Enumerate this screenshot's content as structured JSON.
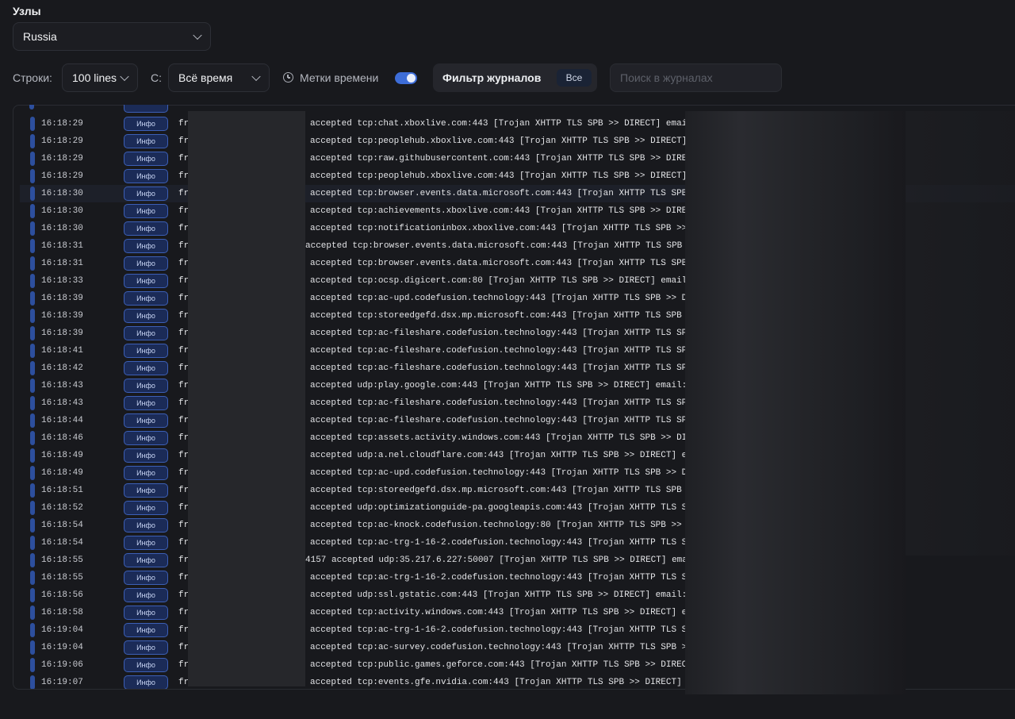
{
  "nodes": {
    "label": "Узлы",
    "selected": "Russia"
  },
  "toolbar": {
    "lines_label": "Строки:",
    "lines_value": "100 lines",
    "from_label": "С:",
    "from_value": "Всё время",
    "timestamps_label": "Метки времени",
    "timestamps_enabled": true,
    "filter_label": "Фильтр журналов",
    "filter_value": "Все",
    "search_placeholder": "Поиск в журналах",
    "accent_color": "#3d6dd8"
  },
  "logs": [
    {
      "time": "16:18:29",
      "level": "Инфо",
      "from": "from",
      "msg": "accepted tcp:chat.xboxlive.com:443 [Trojan XHTTP TLS SPB >> DIRECT] email"
    },
    {
      "time": "16:18:29",
      "level": "Инфо",
      "from": "from",
      "msg": "accepted tcp:peoplehub.xboxlive.com:443 [Trojan XHTTP TLS SPB >> DIRECT]"
    },
    {
      "time": "16:18:29",
      "level": "Инфо",
      "from": "from",
      "msg": "accepted tcp:raw.githubusercontent.com:443 [Trojan XHTTP TLS SPB >> DIRE"
    },
    {
      "time": "16:18:29",
      "level": "Инфо",
      "from": "from",
      "msg": "accepted tcp:peoplehub.xboxlive.com:443 [Trojan XHTTP TLS SPB >> DIRECT]"
    },
    {
      "time": "16:18:30",
      "level": "Инфо",
      "from": "from",
      "msg": "accepted tcp:browser.events.data.microsoft.com:443 [Trojan XHTTP TLS SPB"
    },
    {
      "time": "16:18:30",
      "level": "Инфо",
      "from": "from",
      "msg": "accepted tcp:achievements.xboxlive.com:443 [Trojan XHTTP TLS SPB >> DIRE"
    },
    {
      "time": "16:18:30",
      "level": "Инфо",
      "from": "from",
      "msg": "accepted tcp:notificationinbox.xboxlive.com:443 [Trojan XHTTP TLS SPB >>"
    },
    {
      "time": "16:18:31",
      "level": "Инфо",
      "from": "from",
      "msg": "accepted tcp:browser.events.data.microsoft.com:443 [Trojan XHTTP TLS SPB"
    },
    {
      "time": "16:18:31",
      "level": "Инфо",
      "from": "from",
      "msg": "accepted tcp:browser.events.data.microsoft.com:443 [Trojan XHTTP TLS SPB"
    },
    {
      "time": "16:18:33",
      "level": "Инфо",
      "from": "from",
      "msg": "accepted tcp:ocsp.digicert.com:80 [Trojan XHTTP TLS SPB >> DIRECT] email"
    },
    {
      "time": "16:18:39",
      "level": "Инфо",
      "from": "from",
      "msg": "accepted tcp:ac-upd.codefusion.technology:443 [Trojan XHTTP TLS SPB >> D"
    },
    {
      "time": "16:18:39",
      "level": "Инфо",
      "from": "from",
      "msg": "accepted tcp:storeedgefd.dsx.mp.microsoft.com:443 [Trojan XHTTP TLS SPB"
    },
    {
      "time": "16:18:39",
      "level": "Инфо",
      "from": "from",
      "msg": "accepted tcp:ac-fileshare.codefusion.technology:443 [Trojan XHTTP TLS SP"
    },
    {
      "time": "16:18:41",
      "level": "Инфо",
      "from": "from",
      "msg": "accepted tcp:ac-fileshare.codefusion.technology:443 [Trojan XHTTP TLS SP"
    },
    {
      "time": "16:18:42",
      "level": "Инфо",
      "from": "from",
      "msg": "accepted tcp:ac-fileshare.codefusion.technology:443 [Trojan XHTTP TLS SP"
    },
    {
      "time": "16:18:43",
      "level": "Инфо",
      "from": "from",
      "msg": "accepted udp:play.google.com:443 [Trojan XHTTP TLS SPB >> DIRECT] email:"
    },
    {
      "time": "16:18:43",
      "level": "Инфо",
      "from": "from",
      "msg": "accepted tcp:ac-fileshare.codefusion.technology:443 [Trojan XHTTP TLS SP"
    },
    {
      "time": "16:18:44",
      "level": "Инфо",
      "from": "from",
      "msg": "accepted tcp:ac-fileshare.codefusion.technology:443 [Trojan XHTTP TLS SP"
    },
    {
      "time": "16:18:46",
      "level": "Инфо",
      "from": "from",
      "msg": "accepted tcp:assets.activity.windows.com:443 [Trojan XHTTP TLS SPB >> DI"
    },
    {
      "time": "16:18:49",
      "level": "Инфо",
      "from": "from",
      "msg": "accepted udp:a.nel.cloudflare.com:443 [Trojan XHTTP TLS SPB >> DIRECT] e"
    },
    {
      "time": "16:18:49",
      "level": "Инфо",
      "from": "from",
      "msg": "accepted tcp:ac-upd.codefusion.technology:443 [Trojan XHTTP TLS SPB >> D"
    },
    {
      "time": "16:18:51",
      "level": "Инфо",
      "from": "from",
      "msg": "accepted tcp:storeedgefd.dsx.mp.microsoft.com:443 [Trojan XHTTP TLS SPB"
    },
    {
      "time": "16:18:52",
      "level": "Инфо",
      "from": "from",
      "msg": "accepted udp:optimizationguide-pa.googleapis.com:443 [Trojan XHTTP TLS S"
    },
    {
      "time": "16:18:54",
      "level": "Инфо",
      "from": "from",
      "msg": "accepted tcp:ac-knock.codefusion.technology:80 [Trojan XHTTP TLS SPB >>"
    },
    {
      "time": "16:18:54",
      "level": "Инфо",
      "from": "from",
      "msg": "accepted tcp:ac-trg-1-16-2.codefusion.technology:443 [Trojan XHTTP TLS S"
    },
    {
      "time": "16:18:55",
      "level": "Инфо",
      "from": "from",
      "msg": "4157 accepted udp:35.217.6.227:50007 [Trojan XHTTP TLS SPB >> DIRECT] ema"
    },
    {
      "time": "16:18:55",
      "level": "Инфо",
      "from": "from",
      "msg": "accepted tcp:ac-trg-1-16-2.codefusion.technology:443 [Trojan XHTTP TLS S"
    },
    {
      "time": "16:18:56",
      "level": "Инфо",
      "from": "from",
      "msg": "accepted udp:ssl.gstatic.com:443 [Trojan XHTTP TLS SPB >> DIRECT] email:"
    },
    {
      "time": "16:18:58",
      "level": "Инфо",
      "from": "from",
      "msg": "accepted tcp:activity.windows.com:443 [Trojan XHTTP TLS SPB >> DIRECT] e"
    },
    {
      "time": "16:19:04",
      "level": "Инфо",
      "from": "from",
      "msg": "accepted tcp:ac-trg-1-16-2.codefusion.technology:443 [Trojan XHTTP TLS S"
    },
    {
      "time": "16:19:04",
      "level": "Инфо",
      "from": "from",
      "msg": "accepted tcp:ac-survey.codefusion.technology:443 [Trojan XHTTP TLS SPB >"
    },
    {
      "time": "16:19:06",
      "level": "Инфо",
      "from": "from",
      "msg": "accepted tcp:public.games.geforce.com:443 [Trojan XHTTP TLS SPB >> DIREC"
    },
    {
      "time": "16:19:07",
      "level": "Инфо",
      "from": "from",
      "msg": "accepted tcp:events.gfe.nvidia.com:443 [Trojan XHTTP TLS SPB >> DIRECT]"
    }
  ]
}
